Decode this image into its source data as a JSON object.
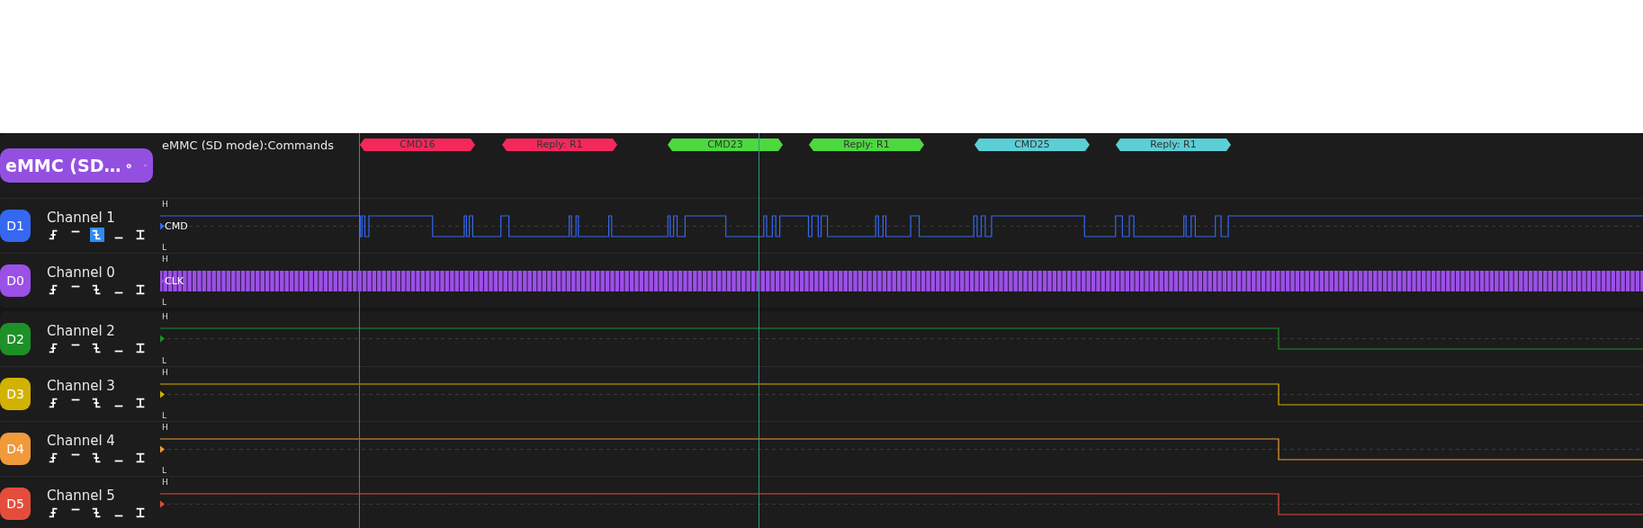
{
  "decoder": {
    "button_label": "eMMC (SD…",
    "track_label": "eMMC (SD mode):Commands",
    "annotations": [
      {
        "label": "CMD16",
        "color": "#f5285c"
      },
      {
        "label": "Reply: R1",
        "color": "#f5285c"
      },
      {
        "label": "CMD23",
        "color": "#4cd93f"
      },
      {
        "label": "Reply: R1",
        "color": "#4cd93f"
      },
      {
        "label": "CMD25",
        "color": "#5ccfd6"
      },
      {
        "label": "Reply: R1",
        "color": "#5ccfd6"
      }
    ]
  },
  "channel_groups": [
    {
      "channels": [
        {
          "badge": "D1",
          "name": "Channel 1",
          "color": "#3568f0",
          "signal": "CMD",
          "kind": "cmd",
          "high": "H",
          "low": "L",
          "triggers": [
            {
              "kind": "rising",
              "selected": false
            },
            {
              "kind": "high",
              "selected": false
            },
            {
              "kind": "falling",
              "selected": true
            },
            {
              "kind": "low",
              "selected": false
            },
            {
              "kind": "either",
              "selected": false
            }
          ]
        },
        {
          "badge": "D0",
          "name": "Channel 0",
          "color": "#9b50e6",
          "signal": "CLK",
          "kind": "clock",
          "high": "H",
          "low": "L",
          "triggers": [
            {
              "kind": "rising",
              "selected": false
            },
            {
              "kind": "high",
              "selected": false
            },
            {
              "kind": "falling",
              "selected": false
            },
            {
              "kind": "low",
              "selected": false
            },
            {
              "kind": "either",
              "selected": false
            }
          ]
        }
      ]
    },
    {
      "channels": [
        {
          "badge": "D2",
          "name": "Channel 2",
          "color": "#1d9127",
          "kind": "data",
          "high": "H",
          "low": "L",
          "triggers": [
            {
              "kind": "rising",
              "selected": false
            },
            {
              "kind": "high",
              "selected": false
            },
            {
              "kind": "falling",
              "selected": false
            },
            {
              "kind": "low",
              "selected": false
            },
            {
              "kind": "either",
              "selected": false
            }
          ]
        },
        {
          "badge": "D3",
          "name": "Channel 3",
          "color": "#d2b200",
          "kind": "data",
          "high": "H",
          "low": "L",
          "triggers": [
            {
              "kind": "rising",
              "selected": false
            },
            {
              "kind": "high",
              "selected": false
            },
            {
              "kind": "falling",
              "selected": false
            },
            {
              "kind": "low",
              "selected": false
            },
            {
              "kind": "either",
              "selected": false
            }
          ]
        },
        {
          "badge": "D4",
          "name": "Channel 4",
          "color": "#f09a3a",
          "kind": "data",
          "high": "H",
          "low": "L",
          "triggers": [
            {
              "kind": "rising",
              "selected": false
            },
            {
              "kind": "high",
              "selected": false
            },
            {
              "kind": "falling",
              "selected": false
            },
            {
              "kind": "low",
              "selected": false
            },
            {
              "kind": "either",
              "selected": false
            }
          ]
        },
        {
          "badge": "D5",
          "name": "Channel 5",
          "color": "#e44d3c",
          "kind": "data",
          "high": "H",
          "triggers": [
            {
              "kind": "rising",
              "selected": false
            },
            {
              "kind": "high",
              "selected": false
            },
            {
              "kind": "falling",
              "selected": false
            },
            {
              "kind": "low",
              "selected": false
            },
            {
              "kind": "either",
              "selected": false
            }
          ]
        }
      ]
    }
  ]
}
